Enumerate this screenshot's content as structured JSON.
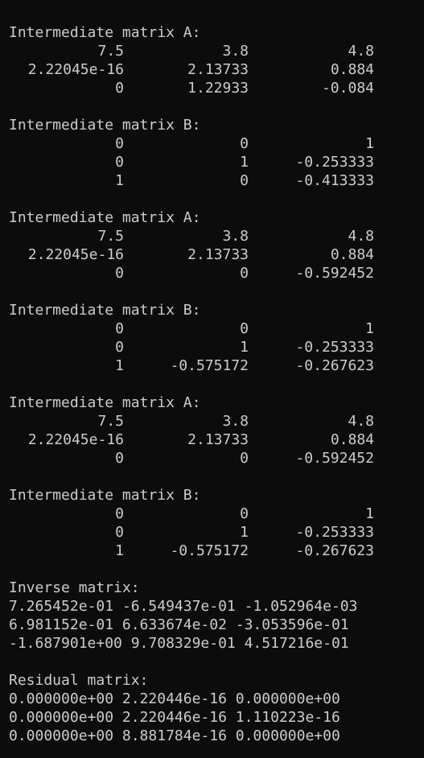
{
  "terminal": {
    "blocks": [
      {
        "kind": "matrix",
        "title": "Intermediate matrix A:",
        "rows": [
          [
            "7.5",
            "3.8",
            "4.8"
          ],
          [
            "2.22045e-16",
            "2.13733",
            "0.884"
          ],
          [
            "0",
            "1.22933",
            "-0.084"
          ]
        ]
      },
      {
        "kind": "matrix",
        "title": "Intermediate matrix B:",
        "rows": [
          [
            "0",
            "0",
            "1"
          ],
          [
            "0",
            "1",
            "-0.253333"
          ],
          [
            "1",
            "0",
            "-0.413333"
          ]
        ]
      },
      {
        "kind": "matrix",
        "title": "Intermediate matrix A:",
        "rows": [
          [
            "7.5",
            "3.8",
            "4.8"
          ],
          [
            "2.22045e-16",
            "2.13733",
            "0.884"
          ],
          [
            "0",
            "0",
            "-0.592452"
          ]
        ]
      },
      {
        "kind": "matrix",
        "title": "Intermediate matrix B:",
        "rows": [
          [
            "0",
            "0",
            "1"
          ],
          [
            "0",
            "1",
            "-0.253333"
          ],
          [
            "1",
            "-0.575172",
            "-0.267623"
          ]
        ]
      },
      {
        "kind": "matrix",
        "title": "Intermediate matrix A:",
        "rows": [
          [
            "7.5",
            "3.8",
            "4.8"
          ],
          [
            "2.22045e-16",
            "2.13733",
            "0.884"
          ],
          [
            "0",
            "0",
            "-0.592452"
          ]
        ]
      },
      {
        "kind": "matrix",
        "title": "Intermediate matrix B:",
        "rows": [
          [
            "0",
            "0",
            "1"
          ],
          [
            "0",
            "1",
            "-0.253333"
          ],
          [
            "1",
            "-0.575172",
            "-0.267623"
          ]
        ]
      },
      {
        "kind": "text",
        "title": "Inverse matrix:",
        "lines": [
          "7.265452e-01 -6.549437e-01 -1.052964e-03",
          "6.981152e-01 6.633674e-02 -3.053596e-01",
          "-1.687901e+00 9.708329e-01 4.517216e-01"
        ]
      },
      {
        "kind": "text",
        "title": "Residual matrix:",
        "lines": [
          "0.000000e+00 2.220446e-16 0.000000e+00",
          "0.000000e+00 2.220446e-16 1.110223e-16",
          "0.000000e+00 8.881784e-16 0.000000e+00"
        ]
      }
    ],
    "colors": {
      "background": "#0c0c0c",
      "foreground": "#cccccc"
    }
  }
}
